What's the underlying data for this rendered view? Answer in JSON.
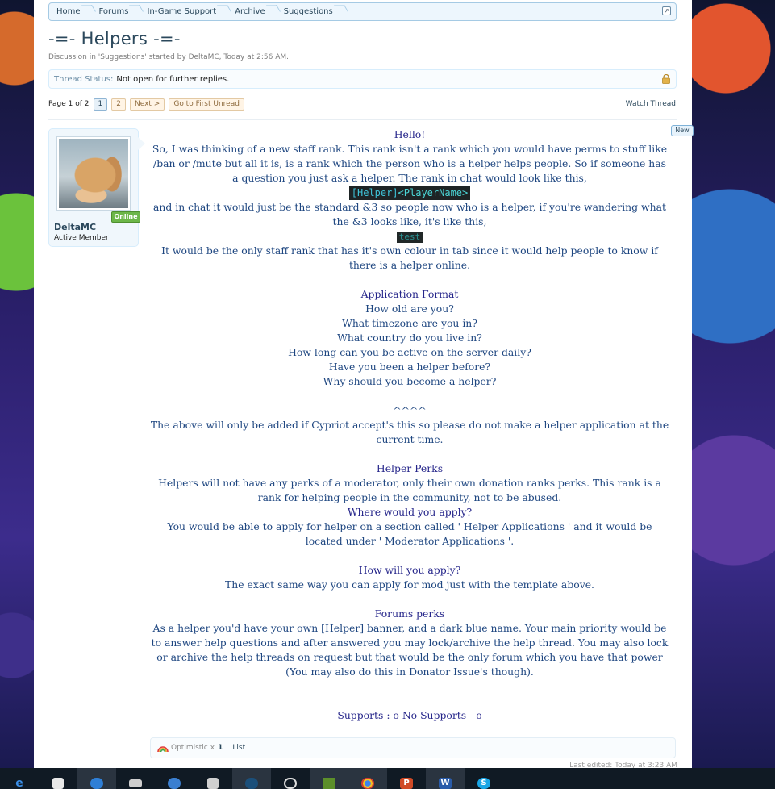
{
  "breadcrumb": [
    "Home",
    "Forums",
    "In-Game Support",
    "Archive",
    "Suggestions"
  ],
  "thread": {
    "title": "-=- Helpers -=-",
    "meta": "Discussion in 'Suggestions' started by DeltaMC, Today at 2:56 AM.",
    "status_label": "Thread Status:",
    "status_value": "Not open for further replies."
  },
  "pagenav": {
    "label": "Page 1 of 2",
    "pages": [
      "1",
      "2"
    ],
    "next": "Next >",
    "first_unread": "Go to First Unread",
    "watch": "Watch Thread"
  },
  "user": {
    "name": "DeltaMC",
    "title": "Active Member",
    "online": "Online"
  },
  "new_badge": "New",
  "post": {
    "l1": "Hello!",
    "l2": "So, I was thinking of a new staff rank. This rank isn't a rank which you would have perms to stuff like /ban or /mute but all it is, is a rank which the person who is a helper helps people. So if someone has a question you just ask a helper. The rank in chat would look like this,",
    "rank_helper": "[Helper]",
    "rank_name": "<PlayerName>",
    "l3": "and in chat it would just be the standard &3 so people now who is a helper, if you're wandering what the &3 looks like, it's like this,",
    "test": "test",
    "l4": "It would be the only staff rank that has it's own colour in tab since it would help people to know if there is a helper online.",
    "app_title": "Application Format",
    "q1": "How old are you?",
    "q2": "What timezone are you in?",
    "q3": "What country do you live in?",
    "q4": "How long can you be active on the server daily?",
    "q5": "Have you been a helper before?",
    "q6": "Why should you become a helper?",
    "carets": "^^^^",
    "l5": "The above will only be added if Cypriot accept's this so please do not make a helper application at the current time.",
    "perks_title": "Helper Perks",
    "l6": "Helpers will not have any perks of a moderator, only their own donation ranks perks. This rank is a rank for helping people in the community, not to be abused.",
    "where_title": "Where would you apply?",
    "l7": "You would be able to apply for helper on a section called ' Helper Applications ' and it would be located under ' Moderator Applications '.",
    "how_title": "How will you apply?",
    "l8": "The exact same way you can apply for mod just with the template above.",
    "forum_title": "Forums perks",
    "l9": "As a helper you'd have your own [Helper] banner, and a dark blue name. Your main priority would be to answer help questions and after answered you may lock/archive the help thread. You may also lock or archive the help threads on request but that would be the only forum which you have that power (You may also do this in Donator Issue's though).",
    "supports": "Supports : o No Supports - o"
  },
  "ratings": {
    "name": "Optimistic",
    "x": "x",
    "count": "1",
    "list": "List"
  },
  "edited": "Last edited: Today at 3:23 AM",
  "taskbar_icons": [
    "edge-icon",
    "store-icon",
    "steam-app-icon",
    "mail-icon",
    "camera-icon",
    "calculator-icon",
    "steam-icon",
    "music-icon",
    "minecraft-icon",
    "chrome-icon",
    "powerpoint-icon",
    "word-icon",
    "skype-icon"
  ],
  "colors": {
    "post_text": "#1e4680",
    "post_heading": "#25258a",
    "forum_blue": "#2b485c",
    "online_green": "#6cb649"
  }
}
